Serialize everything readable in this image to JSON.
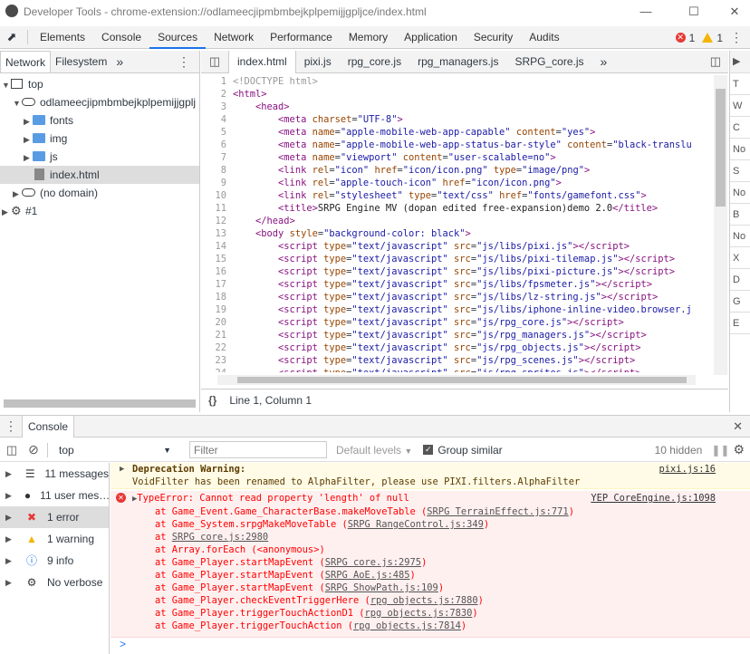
{
  "window": {
    "title": "Developer Tools - chrome-extension://odlameecjipmbmbejkplpemijjgpljce/index.html"
  },
  "main_tabs": [
    "Elements",
    "Console",
    "Sources",
    "Network",
    "Performance",
    "Memory",
    "Application",
    "Security",
    "Audits"
  ],
  "active_main_tab": "Sources",
  "counters": {
    "errors": "1",
    "warnings": "1"
  },
  "navigator": {
    "tabs": [
      "Network",
      "Filesystem"
    ],
    "more": "»",
    "tree": {
      "top": "top",
      "origin": "odlameecjipmbmbejkplpemijjgplj",
      "folders": [
        "fonts",
        "img",
        "js"
      ],
      "selected_file": "index.html",
      "no_domain": "(no domain)",
      "worker": "#1"
    }
  },
  "editor": {
    "tabs": [
      "index.html",
      "pixi.js",
      "rpg_core.js",
      "rpg_managers.js",
      "SRPG_core.js"
    ],
    "more": "»",
    "status": {
      "format_icon": "{}",
      "position": "Line 1, Column 1"
    },
    "lines": [
      {
        "n": "1",
        "html": "<span class='cm'>&lt;!DOCTYPE html&gt;</span>"
      },
      {
        "n": "2",
        "html": "<span class='tg'>&lt;html&gt;</span>"
      },
      {
        "n": "3",
        "html": "    <span class='tg'>&lt;head&gt;</span>"
      },
      {
        "n": "4",
        "html": "        <span class='tg'>&lt;meta</span> <span class='at'>charset</span>=<span class='av'>\"UTF-8\"</span><span class='tg'>&gt;</span>"
      },
      {
        "n": "5",
        "html": "        <span class='tg'>&lt;meta</span> <span class='at'>name</span>=<span class='av'>\"apple-mobile-web-app-capable\"</span> <span class='at'>content</span>=<span class='av'>\"yes\"</span><span class='tg'>&gt;</span>"
      },
      {
        "n": "6",
        "html": "        <span class='tg'>&lt;meta</span> <span class='at'>name</span>=<span class='av'>\"apple-mobile-web-app-status-bar-style\"</span> <span class='at'>content</span>=<span class='av'>\"black-translu</span>"
      },
      {
        "n": "7",
        "html": "        <span class='tg'>&lt;meta</span> <span class='at'>name</span>=<span class='av'>\"viewport\"</span> <span class='at'>content</span>=<span class='av'>\"user-scalable=no\"</span><span class='tg'>&gt;</span>"
      },
      {
        "n": "8",
        "html": "        <span class='tg'>&lt;link</span> <span class='at'>rel</span>=<span class='av'>\"icon\"</span> <span class='at'>href</span>=<span class='av'>\"icon/icon.png\"</span> <span class='at'>type</span>=<span class='av'>\"image/png\"</span><span class='tg'>&gt;</span>"
      },
      {
        "n": "9",
        "html": "        <span class='tg'>&lt;link</span> <span class='at'>rel</span>=<span class='av'>\"apple-touch-icon\"</span> <span class='at'>href</span>=<span class='av'>\"icon/icon.png\"</span><span class='tg'>&gt;</span>"
      },
      {
        "n": "10",
        "html": "        <span class='tg'>&lt;link</span> <span class='at'>rel</span>=<span class='av'>\"stylesheet\"</span> <span class='at'>type</span>=<span class='av'>\"text/css\"</span> <span class='at'>href</span>=<span class='av'>\"fonts/gamefont.css\"</span><span class='tg'>&gt;</span>"
      },
      {
        "n": "11",
        "html": "        <span class='tg'>&lt;title&gt;</span><span class='tx'>SRPG Engine MV (dopan edited free-expansion)demo 2.0</span><span class='tg'>&lt;/title&gt;</span>"
      },
      {
        "n": "12",
        "html": "    <span class='tg'>&lt;/head&gt;</span>"
      },
      {
        "n": "13",
        "html": "    <span class='tg'>&lt;body</span> <span class='at'>style</span>=<span class='av'>\"background-color: black\"</span><span class='tg'>&gt;</span>"
      },
      {
        "n": "14",
        "html": "        <span class='tg'>&lt;script</span> <span class='at'>type</span>=<span class='av'>\"text/javascript\"</span> <span class='at'>src</span>=<span class='av'>\"js/libs/pixi.js\"</span><span class='tg'>&gt;&lt;/script&gt;</span>"
      },
      {
        "n": "15",
        "html": "        <span class='tg'>&lt;script</span> <span class='at'>type</span>=<span class='av'>\"text/javascript\"</span> <span class='at'>src</span>=<span class='av'>\"js/libs/pixi-tilemap.js\"</span><span class='tg'>&gt;&lt;/script&gt;</span>"
      },
      {
        "n": "16",
        "html": "        <span class='tg'>&lt;script</span> <span class='at'>type</span>=<span class='av'>\"text/javascript\"</span> <span class='at'>src</span>=<span class='av'>\"js/libs/pixi-picture.js\"</span><span class='tg'>&gt;&lt;/script&gt;</span>"
      },
      {
        "n": "17",
        "html": "        <span class='tg'>&lt;script</span> <span class='at'>type</span>=<span class='av'>\"text/javascript\"</span> <span class='at'>src</span>=<span class='av'>\"js/libs/fpsmeter.js\"</span><span class='tg'>&gt;&lt;/script&gt;</span>"
      },
      {
        "n": "18",
        "html": "        <span class='tg'>&lt;script</span> <span class='at'>type</span>=<span class='av'>\"text/javascript\"</span> <span class='at'>src</span>=<span class='av'>\"js/libs/lz-string.js\"</span><span class='tg'>&gt;&lt;/script&gt;</span>"
      },
      {
        "n": "19",
        "html": "        <span class='tg'>&lt;script</span> <span class='at'>type</span>=<span class='av'>\"text/javascript\"</span> <span class='at'>src</span>=<span class='av'>\"js/libs/iphone-inline-video.browser.j</span>"
      },
      {
        "n": "20",
        "html": "        <span class='tg'>&lt;script</span> <span class='at'>type</span>=<span class='av'>\"text/javascript\"</span> <span class='at'>src</span>=<span class='av'>\"js/rpg_core.js\"</span><span class='tg'>&gt;&lt;/script&gt;</span>"
      },
      {
        "n": "21",
        "html": "        <span class='tg'>&lt;script</span> <span class='at'>type</span>=<span class='av'>\"text/javascript\"</span> <span class='at'>src</span>=<span class='av'>\"js/rpg_managers.js\"</span><span class='tg'>&gt;&lt;/script&gt;</span>"
      },
      {
        "n": "22",
        "html": "        <span class='tg'>&lt;script</span> <span class='at'>type</span>=<span class='av'>\"text/javascript\"</span> <span class='at'>src</span>=<span class='av'>\"js/rpg_objects.js\"</span><span class='tg'>&gt;&lt;/script&gt;</span>"
      },
      {
        "n": "23",
        "html": "        <span class='tg'>&lt;script</span> <span class='at'>type</span>=<span class='av'>\"text/javascript\"</span> <span class='at'>src</span>=<span class='av'>\"js/rpg_scenes.js\"</span><span class='tg'>&gt;&lt;/script&gt;</span>"
      },
      {
        "n": "24",
        "html": "        <span class='tg'>&lt;script</span> <span class='at'>type</span>=<span class='av'>\"text/javascript\"</span> <span class='at'>src</span>=<span class='av'>\"js/rpg_sprites.js\"</span><span class='tg'>&gt;&lt;/script&gt;</span>"
      },
      {
        "n": "25",
        "html": ""
      }
    ]
  },
  "right_panel": {
    "labels": [
      "T",
      "W",
      "C",
      "No",
      "S",
      "No",
      "B",
      "No",
      "X",
      "D",
      "G",
      "E"
    ]
  },
  "drawer": {
    "tab": "Console"
  },
  "console_toolbar": {
    "context": "top",
    "filter_placeholder": "Filter",
    "levels": "Default levels",
    "group_similar": "Group similar",
    "hidden": "10 hidden"
  },
  "console_sidebar": [
    {
      "label": "11 messages",
      "icon": "list-icon"
    },
    {
      "label": "11 user mes…",
      "icon": "user-icon"
    },
    {
      "label": "1 error",
      "icon": "error-icon"
    },
    {
      "label": "1 warning",
      "icon": "warning-icon"
    },
    {
      "label": "9 info",
      "icon": "info-icon"
    },
    {
      "label": "No verbose",
      "icon": "bug-icon"
    }
  ],
  "messages": {
    "warning": {
      "title": "Deprecation Warning:",
      "text": "VoidFilter has been renamed to AlphaFilter, please use PIXI.filters.AlphaFilter",
      "source": "pixi.js:16"
    },
    "error": {
      "title": "TypeError: Cannot read property 'length' of null",
      "source": "YEP CoreEngine.js:1098",
      "stack": [
        {
          "at": "    at Game_Event.Game_CharacterBase.makeMoveTable (",
          "link": "SRPG TerrainEffect.js:771",
          "end": ")"
        },
        {
          "at": "    at Game_System.srpgMakeMoveTable (",
          "link": "SRPG RangeControl.js:349",
          "end": ")"
        },
        {
          "at": "    at ",
          "link": "SRPG core.js:2980",
          "end": ""
        },
        {
          "at": "    at Array.forEach (<anonymous>)",
          "link": "",
          "end": ""
        },
        {
          "at": "    at Game_Player.startMapEvent (",
          "link": "SRPG core.js:2975",
          "end": ")"
        },
        {
          "at": "    at Game_Player.startMapEvent (",
          "link": "SRPG AoE.js:485",
          "end": ")"
        },
        {
          "at": "    at Game_Player.startMapEvent (",
          "link": "SRPG ShowPath.js:109",
          "end": ")"
        },
        {
          "at": "    at Game_Player.checkEventTriggerHere (",
          "link": "rpg objects.js:7880",
          "end": ")"
        },
        {
          "at": "    at Game_Player.triggerTouchActionD1 (",
          "link": "rpg objects.js:7830",
          "end": ")"
        },
        {
          "at": "    at Game_Player.triggerTouchAction (",
          "link": "rpg objects.js:7814",
          "end": ")"
        }
      ]
    }
  },
  "prompt": ">"
}
